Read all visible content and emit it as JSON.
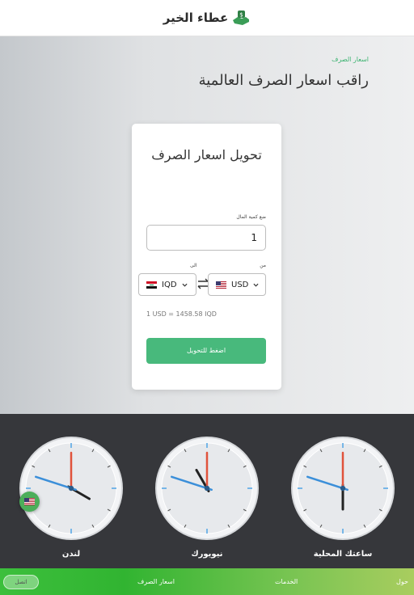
{
  "header": {
    "brand_name": "عطاء الخير",
    "brand_icon": "hands-money-icon"
  },
  "hero": {
    "breadcrumb": "اسعار الصرف",
    "title": "راقب اسعار الصرف العالمية"
  },
  "converter": {
    "title": "تحويل اسعار الصرف",
    "amount_label": "ضع كمية المال",
    "amount_value": "1",
    "to_label": "الى",
    "from_label": "من",
    "to_currency": "IQD",
    "from_currency": "USD",
    "rate_text": "1 USD = 1458.58 IQD",
    "convert_label": "اضغط للتحويل"
  },
  "clocks": [
    {
      "label": "لندن",
      "hour_deg": 120,
      "minute_deg": 288,
      "second_deg": 0
    },
    {
      "label": "نيويورك",
      "hour_deg": 330,
      "minute_deg": 288,
      "second_deg": 0
    },
    {
      "label": "ساعتك المحلية",
      "hour_deg": 180,
      "minute_deg": 288,
      "second_deg": 0
    }
  ],
  "bottom_nav": {
    "about": "حول",
    "services": "الخدمات",
    "exchange": "اسعار الصرف",
    "contact": "اتصل"
  },
  "colors": {
    "accent": "#48b97c",
    "nav_start": "#3cbf3c",
    "nav_end": "#a9cd5f",
    "clocks_bg": "#36373b"
  }
}
